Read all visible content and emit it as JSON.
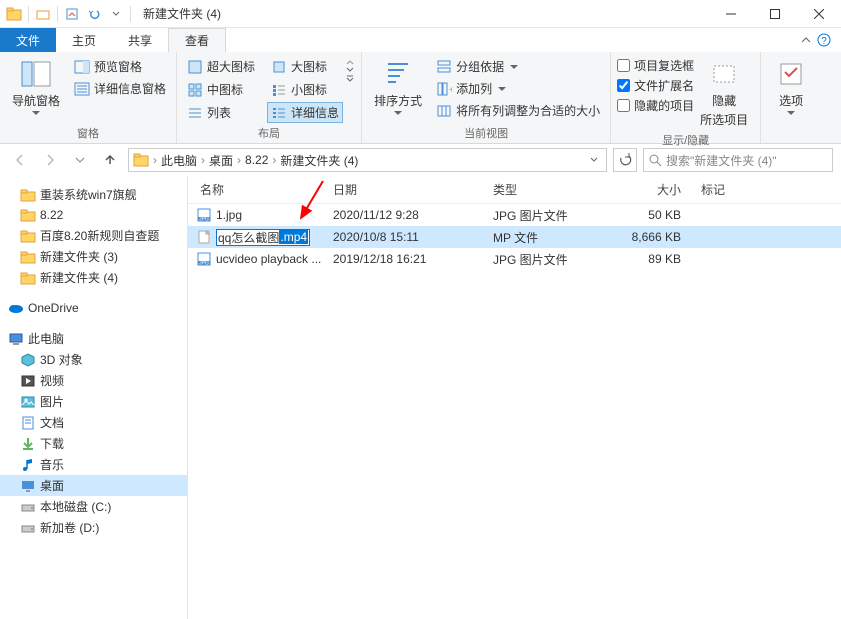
{
  "titlebar": {
    "title": "新建文件夹 (4)"
  },
  "tabs": {
    "file": "文件",
    "home": "主页",
    "share": "共享",
    "view": "查看"
  },
  "ribbon": {
    "group_pane": {
      "nav": "导航窗格",
      "preview": "预览窗格",
      "details": "详细信息窗格",
      "label": "窗格"
    },
    "group_layout": {
      "xlarge": "超大图标",
      "large": "大图标",
      "medium": "中图标",
      "small": "小图标",
      "list": "列表",
      "details_view": "详细信息",
      "label": "布局"
    },
    "group_current": {
      "sort": "排序方式",
      "group_by": "分组依据",
      "add_col": "添加列",
      "fit_cols": "将所有列调整为合适的大小",
      "label": "当前视图"
    },
    "group_showhide": {
      "chk_checkbox": "项目复选框",
      "chk_ext": "文件扩展名",
      "chk_hidden": "隐藏的项目",
      "hide_btn": "隐藏\n所选项目",
      "hide_btn_l1": "隐藏",
      "hide_btn_l2": "所选项目",
      "label": "显示/隐藏"
    },
    "group_options": {
      "options": "选项"
    }
  },
  "breadcrumb": {
    "pc": "此电脑",
    "desktop": "桌面",
    "folder1": "8.22",
    "folder2": "新建文件夹 (4)"
  },
  "search": {
    "placeholder": "搜索\"新建文件夹 (4)\""
  },
  "tree": {
    "items": [
      {
        "label": "重装系统win7旗舰",
        "icon": "folder"
      },
      {
        "label": "8.22",
        "icon": "folder"
      },
      {
        "label": "百度8.20新规则自查题",
        "icon": "folder"
      },
      {
        "label": "新建文件夹 (3)",
        "icon": "folder"
      },
      {
        "label": "新建文件夹 (4)",
        "icon": "folder"
      }
    ],
    "onedrive": "OneDrive",
    "thispc": "此电脑",
    "pc_children": [
      {
        "label": "3D 对象",
        "icon": "3d"
      },
      {
        "label": "视频",
        "icon": "video"
      },
      {
        "label": "图片",
        "icon": "picture"
      },
      {
        "label": "文档",
        "icon": "document"
      },
      {
        "label": "下载",
        "icon": "download"
      },
      {
        "label": "音乐",
        "icon": "music"
      },
      {
        "label": "桌面",
        "icon": "desktop",
        "selected": true
      },
      {
        "label": "本地磁盘 (C:)",
        "icon": "drive"
      },
      {
        "label": "新加卷 (D:)",
        "icon": "drive"
      }
    ]
  },
  "columns": {
    "name": "名称",
    "date": "日期",
    "type": "类型",
    "size": "大小",
    "tag": "标记"
  },
  "files": [
    {
      "name": "1.jpg",
      "date": "2020/11/12 9:28",
      "type": "JPG 图片文件",
      "size": "50 KB",
      "icon": "jpg"
    },
    {
      "name_base": "qq怎么截图",
      "name_ext": ".mp4",
      "date": "2020/10/8 15:11",
      "type": "MP 文件",
      "size": "8,666 KB",
      "icon": "blank",
      "renaming": true
    },
    {
      "name": "ucvideo playback ...",
      "date": "2019/12/18 16:21",
      "type": "JPG 图片文件",
      "size": "89 KB",
      "icon": "jpg"
    }
  ]
}
